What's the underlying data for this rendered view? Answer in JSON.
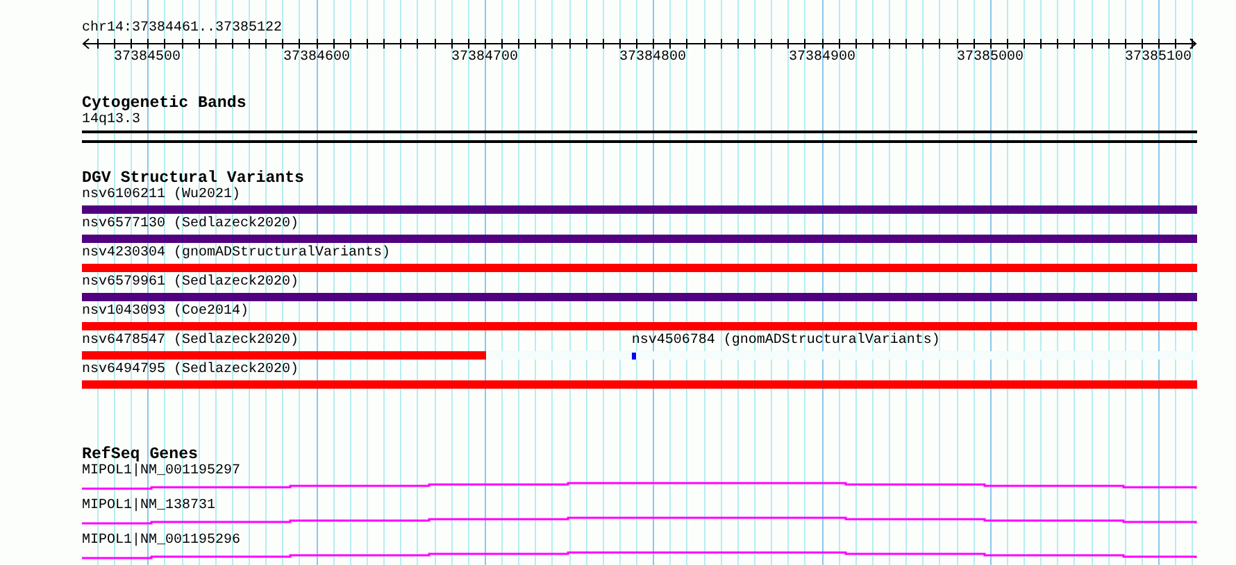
{
  "ruler": {
    "position": "chr14:37384461..37385122",
    "tick_labels": [
      "37384500",
      "37384600",
      "37384700",
      "37384800",
      "37384900",
      "37385000",
      "37385100"
    ]
  },
  "tracks": [
    {
      "kind": "bands",
      "title": "Cytogenetic Bands",
      "items": [
        {
          "label": "14q13.3"
        }
      ]
    },
    {
      "kind": "variants",
      "title": "DGV Structural Variants",
      "rows": [
        {
          "items": [
            {
              "kind": "full",
              "label": "nsv6106211 (Wu2021)",
              "color": "#500080"
            }
          ]
        },
        {
          "items": [
            {
              "kind": "full",
              "label": "nsv6577130 (Sedlazeck2020)",
              "color": "#500080"
            }
          ]
        },
        {
          "items": [
            {
              "kind": "full",
              "label": "nsv4230304 (gnomADStructuralVariants)",
              "color": "#ff0000"
            }
          ]
        },
        {
          "items": [
            {
              "kind": "full",
              "label": "nsv6579961 (Sedlazeck2020)",
              "color": "#500080"
            }
          ]
        },
        {
          "items": [
            {
              "kind": "full",
              "label": "nsv1043093 (Coe2014)",
              "color": "#ff0000"
            }
          ]
        },
        {
          "items": [
            {
              "kind": "partial",
              "label": "nsv6478547 (Sedlazeck2020)",
              "color": "#ff0000",
              "level": 0.363
            },
            {
              "kind": "point",
              "label": "nsv4506784 (gnomADStructuralVariants)",
              "color": "#0000ff",
              "level": 0.493
            }
          ]
        },
        {
          "items": [
            {
              "kind": "full",
              "label": "nsv6494795 (Sedlazeck2020)",
              "color": "#ff0000"
            }
          ]
        }
      ]
    },
    {
      "kind": "genes",
      "title": "RefSeq Genes",
      "items": [
        {
          "label": "MIPOL1|NM_001195297"
        },
        {
          "label": "MIPOL1|NM_138731"
        },
        {
          "label": "MIPOL1|NM_001195296"
        }
      ]
    }
  ]
}
